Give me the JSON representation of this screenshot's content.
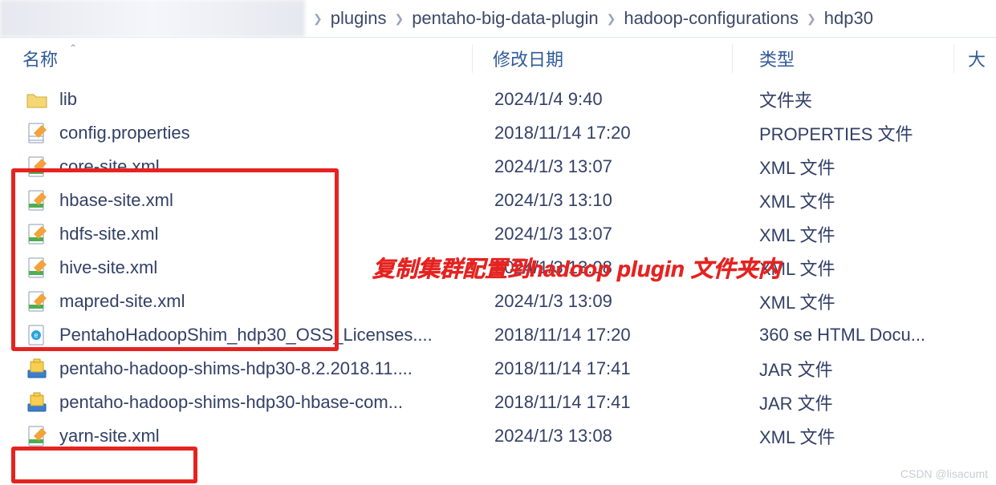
{
  "breadcrumb": {
    "items": [
      "plugins",
      "pentaho-big-data-plugin",
      "hadoop-configurations",
      "hdp30"
    ]
  },
  "columns": {
    "name": "名称",
    "date": "修改日期",
    "type": "类型",
    "size": "大"
  },
  "rows": [
    {
      "icon": "folder",
      "name": "lib",
      "date": "2024/1/4 9:40",
      "type": "文件夹"
    },
    {
      "icon": "prop",
      "name": "config.properties",
      "date": "2018/11/14 17:20",
      "type": "PROPERTIES 文件"
    },
    {
      "icon": "xml",
      "name": "core-site.xml",
      "date": "2024/1/3 13:07",
      "type": "XML 文件"
    },
    {
      "icon": "xml",
      "name": "hbase-site.xml",
      "date": "2024/1/3 13:10",
      "type": "XML 文件"
    },
    {
      "icon": "xml",
      "name": "hdfs-site.xml",
      "date": "2024/1/3 13:07",
      "type": "XML 文件"
    },
    {
      "icon": "xml",
      "name": "hive-site.xml",
      "date": "2024/1/3 13:08",
      "type": "XML 文件"
    },
    {
      "icon": "xml",
      "name": "mapred-site.xml",
      "date": "2024/1/3 13:09",
      "type": "XML 文件"
    },
    {
      "icon": "html",
      "name": "PentahoHadoopShim_hdp30_OSS_Licenses....",
      "date": "2018/11/14 17:20",
      "type": "360 se HTML Docu..."
    },
    {
      "icon": "jar",
      "name": "pentaho-hadoop-shims-hdp30-8.2.2018.11....",
      "date": "2018/11/14 17:41",
      "type": "JAR 文件"
    },
    {
      "icon": "jar",
      "name": "pentaho-hadoop-shims-hdp30-hbase-com...",
      "date": "2018/11/14 17:41",
      "type": "JAR 文件"
    },
    {
      "icon": "xml",
      "name": "yarn-site.xml",
      "date": "2024/1/3 13:08",
      "type": "XML 文件"
    }
  ],
  "annotation": "复制集群配置到hadoop plugin 文件夹内",
  "watermark": "CSDN @lisacumt"
}
